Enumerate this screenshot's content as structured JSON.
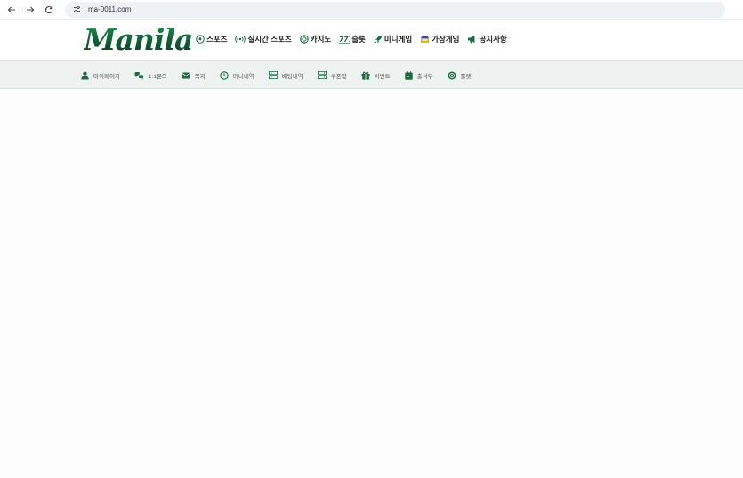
{
  "browser": {
    "url": "ma-0011.com",
    "icons": [
      "back-arrow-icon",
      "forward-arrow-icon",
      "reload-icon",
      "site-settings-icon"
    ]
  },
  "header": {
    "logo_text": "Manila",
    "nav": [
      {
        "label": "스포츠",
        "icon": "soccer-ball-icon"
      },
      {
        "label": "실시간 스포츠",
        "icon": "live-broadcast-icon"
      },
      {
        "label": "카지노",
        "icon": "casino-chip-icon"
      },
      {
        "label": "슬롯",
        "icon": "slot-777-icon"
      },
      {
        "label": "미니게임",
        "icon": "rocket-icon"
      },
      {
        "label": "가상게임",
        "icon": "virtual-game-icon"
      },
      {
        "label": "공지사항",
        "icon": "megaphone-icon"
      }
    ]
  },
  "subnav": [
    {
      "label": "마이페이지",
      "icon": "user-icon"
    },
    {
      "label": "1:1문의",
      "icon": "chat-icon"
    },
    {
      "label": "쪽지",
      "icon": "envelope-icon"
    },
    {
      "label": "머니내역",
      "icon": "clock-icon"
    },
    {
      "label": "배팅내역",
      "icon": "list-icon"
    },
    {
      "label": "쿠폰함",
      "icon": "coupon-icon"
    },
    {
      "label": "이벤트",
      "icon": "gift-icon"
    },
    {
      "label": "출석부",
      "icon": "calendar-icon"
    },
    {
      "label": "룰렛",
      "icon": "roulette-icon"
    }
  ],
  "colors": {
    "brand_green": "#0e5a32",
    "icon_green": "#1b6b3f",
    "subbar_bg": "#eef2f0"
  }
}
